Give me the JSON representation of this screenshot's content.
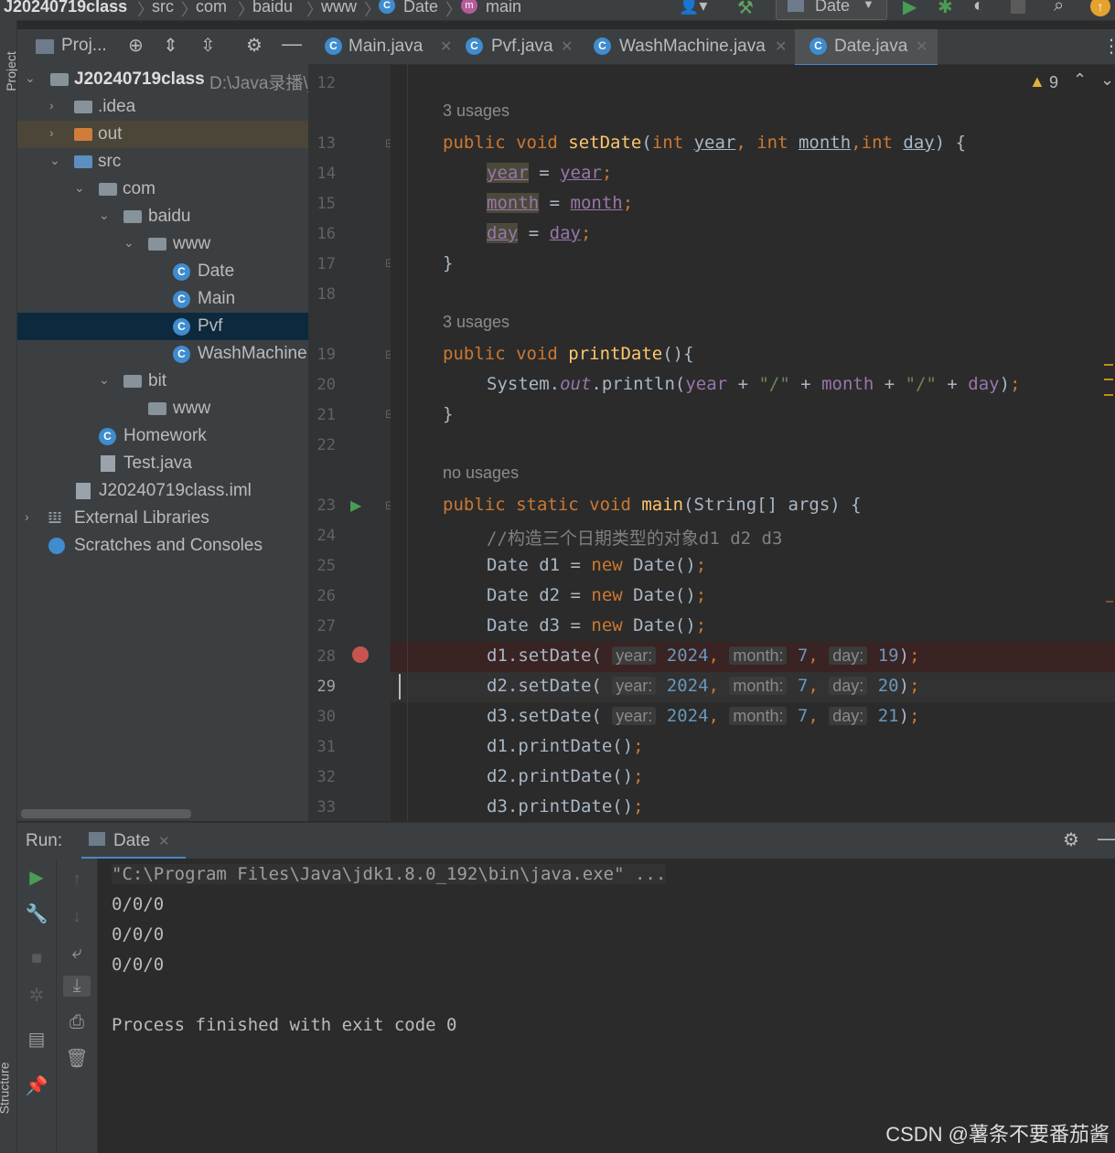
{
  "breadcrumb": {
    "project": "J20240719class",
    "items": [
      "src",
      "com",
      "baidu",
      "www",
      "Date",
      "main"
    ]
  },
  "toolbar": {
    "run_config": "Date"
  },
  "left_strip": {
    "project_label": "Project",
    "structure_label": "Structure"
  },
  "project_panel": {
    "title": "Proj...",
    "tree": [
      {
        "label": "J20240719class",
        "suffix": "D:\\Java录播\\j"
      },
      {
        "label": ".idea"
      },
      {
        "label": "out"
      },
      {
        "label": "src"
      },
      {
        "label": "com"
      },
      {
        "label": "baidu"
      },
      {
        "label": "www"
      },
      {
        "label": "Date"
      },
      {
        "label": "Main"
      },
      {
        "label": "Pvf"
      },
      {
        "label": "WashMachine"
      },
      {
        "label": "bit"
      },
      {
        "label": "www"
      },
      {
        "label": "Homework"
      },
      {
        "label": "Test.java"
      },
      {
        "label": "J20240719class.iml"
      },
      {
        "label": "External Libraries"
      },
      {
        "label": "Scratches and Consoles"
      }
    ]
  },
  "tabs": [
    "Main.java",
    "Pvf.java",
    "WashMachine.java",
    "Date.java"
  ],
  "editor": {
    "warnings": "9",
    "usages": [
      "3 usages",
      "3 usages",
      "no usages"
    ],
    "line_numbers": [
      "12",
      "13",
      "14",
      "15",
      "16",
      "17",
      "18",
      "19",
      "20",
      "21",
      "22",
      "23",
      "24",
      "25",
      "26",
      "27",
      "28",
      "29",
      "30",
      "31",
      "32",
      "33"
    ],
    "comment": "//构造三个日期类型的对象d1 d2 d3",
    "calls": [
      {
        "obj": "d1",
        "year": "2024",
        "month": "7",
        "day": "19"
      },
      {
        "obj": "d2",
        "year": "2024",
        "month": "7",
        "day": "20"
      },
      {
        "obj": "d3",
        "year": "2024",
        "month": "7",
        "day": "21"
      }
    ]
  },
  "run": {
    "label": "Run:",
    "tab": "Date",
    "console": [
      "\"C:\\Program Files\\Java\\jdk1.8.0_192\\bin\\java.exe\" ...",
      "0/0/0",
      "0/0/0",
      "0/0/0",
      "",
      "Process finished with exit code 0"
    ]
  },
  "watermark": "CSDN @薯条不要番茄酱"
}
